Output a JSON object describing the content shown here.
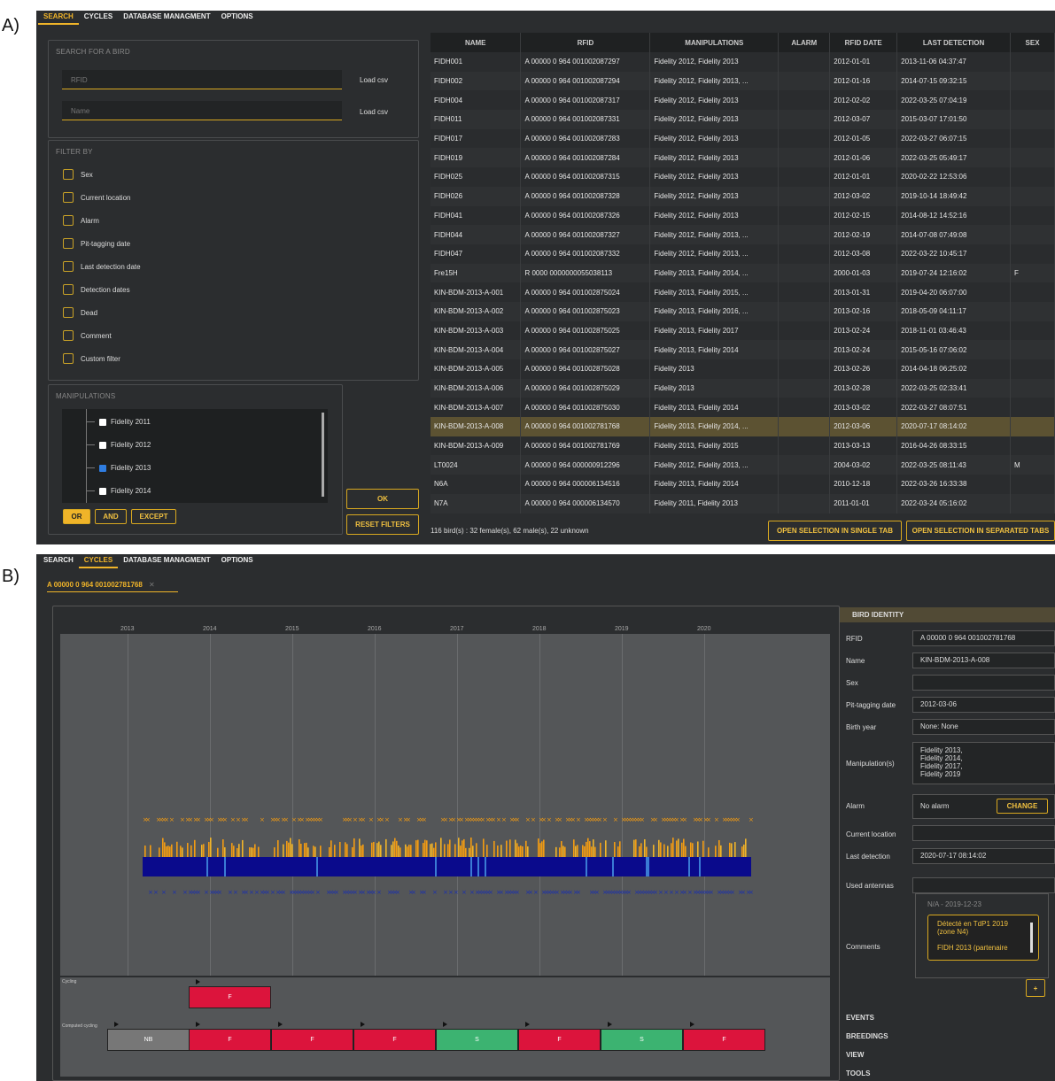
{
  "labels": {
    "a": "A)",
    "b": "B)"
  },
  "a": {
    "menu": [
      "SEARCH",
      "CYCLES",
      "DATABASE MANAGMENT",
      "OPTIONS"
    ],
    "search": {
      "title": "SEARCH FOR A BIRD",
      "rfid_ph": "RFID",
      "name_ph": "Name",
      "load": "Load csv"
    },
    "filter": {
      "title": "FILTER BY",
      "items": [
        "Sex",
        "Current location",
        "Alarm",
        "Pit-tagging date",
        "Last detection date",
        "Detection dates",
        "Dead",
        "Comment",
        "Custom filter"
      ]
    },
    "manip": {
      "title": "MANIPULATIONS",
      "items": [
        {
          "label": "Fidelity 2011",
          "checked": false
        },
        {
          "label": "Fidelity 2012",
          "checked": false
        },
        {
          "label": "Fidelity 2013",
          "checked": true
        },
        {
          "label": "Fidelity 2014",
          "checked": false
        }
      ],
      "ops": [
        "OR",
        "AND",
        "EXCEPT"
      ]
    },
    "ok": "OK",
    "reset": "RESET FILTERS",
    "columns": [
      "NAME",
      "RFID",
      "MANIPULATIONS",
      "ALARM",
      "RFID DATE",
      "LAST DETECTION",
      "SEX"
    ],
    "rows": [
      [
        "FIDH001",
        "A 00000 0 964 001002087297",
        "Fidelity 2012, Fidelity 2013",
        "",
        "2012-01-01",
        "2013-11-06 04:37:47",
        ""
      ],
      [
        "FIDH002",
        "A 00000 0 964 001002087294",
        "Fidelity 2012, Fidelity 2013, ...",
        "",
        "2012-01-16",
        "2014-07-15 09:32:15",
        ""
      ],
      [
        "FIDH004",
        "A 00000 0 964 001002087317",
        "Fidelity 2012, Fidelity 2013",
        "",
        "2012-02-02",
        "2022-03-25 07:04:19",
        ""
      ],
      [
        "FIDH011",
        "A 00000 0 964 001002087331",
        "Fidelity 2012, Fidelity 2013",
        "",
        "2012-03-07",
        "2015-03-07 17:01:50",
        ""
      ],
      [
        "FIDH017",
        "A 00000 0 964 001002087283",
        "Fidelity 2012, Fidelity 2013",
        "",
        "2012-01-05",
        "2022-03-27 06:07:15",
        ""
      ],
      [
        "FIDH019",
        "A 00000 0 964 001002087284",
        "Fidelity 2012, Fidelity 2013",
        "",
        "2012-01-06",
        "2022-03-25 05:49:17",
        ""
      ],
      [
        "FIDH025",
        "A 00000 0 964 001002087315",
        "Fidelity 2012, Fidelity 2013",
        "",
        "2012-01-01",
        "2020-02-22 12:53:06",
        ""
      ],
      [
        "FIDH026",
        "A 00000 0 964 001002087328",
        "Fidelity 2012, Fidelity 2013",
        "",
        "2012-03-02",
        "2019-10-14 18:49:42",
        ""
      ],
      [
        "FIDH041",
        "A 00000 0 964 001002087326",
        "Fidelity 2012, Fidelity 2013",
        "",
        "2012-02-15",
        "2014-08-12 14:52:16",
        ""
      ],
      [
        "FIDH044",
        "A 00000 0 964 001002087327",
        "Fidelity 2012, Fidelity 2013, ...",
        "",
        "2012-02-19",
        "2014-07-08 07:49:08",
        ""
      ],
      [
        "FIDH047",
        "A 00000 0 964 001002087332",
        "Fidelity 2012, Fidelity 2013, ...",
        "",
        "2012-03-08",
        "2022-03-22 10:45:17",
        ""
      ],
      [
        "Fre15H",
        "R 0000 0000000055038113",
        "Fidelity 2013, Fidelity 2014, ...",
        "",
        "2000-01-03",
        "2019-07-24 12:16:02",
        "F"
      ],
      [
        "KIN-BDM-2013-A-001",
        "A 00000 0 964 001002875024",
        "Fidelity 2013, Fidelity 2015, ...",
        "",
        "2013-01-31",
        "2019-04-20 06:07:00",
        ""
      ],
      [
        "KIN-BDM-2013-A-002",
        "A 00000 0 964 001002875023",
        "Fidelity 2013, Fidelity 2016, ...",
        "",
        "2013-02-16",
        "2018-05-09 04:11:17",
        ""
      ],
      [
        "KIN-BDM-2013-A-003",
        "A 00000 0 964 001002875025",
        "Fidelity 2013, Fidelity 2017",
        "",
        "2013-02-24",
        "2018-11-01 03:46:43",
        ""
      ],
      [
        "KIN-BDM-2013-A-004",
        "A 00000 0 964 001002875027",
        "Fidelity 2013, Fidelity 2014",
        "",
        "2013-02-24",
        "2015-05-16 07:06:02",
        ""
      ],
      [
        "KIN-BDM-2013-A-005",
        "A 00000 0 964 001002875028",
        "Fidelity 2013",
        "",
        "2013-02-26",
        "2014-04-18 06:25:02",
        ""
      ],
      [
        "KIN-BDM-2013-A-006",
        "A 00000 0 964 001002875029",
        "Fidelity 2013",
        "",
        "2013-02-28",
        "2022-03-25 02:33:41",
        ""
      ],
      [
        "KIN-BDM-2013-A-007",
        "A 00000 0 964 001002875030",
        "Fidelity 2013, Fidelity 2014",
        "",
        "2013-03-02",
        "2022-03-27 08:07:51",
        ""
      ],
      [
        "KIN-BDM-2013-A-008",
        "A 00000 0 964 001002781768",
        "Fidelity 2013, Fidelity 2014, ...",
        "",
        "2012-03-06",
        "2020-07-17 08:14:02",
        ""
      ],
      [
        "KIN-BDM-2013-A-009",
        "A 00000 0 964 001002781769",
        "Fidelity 2013, Fidelity 2015",
        "",
        "2013-03-13",
        "2016-04-26 08:33:15",
        ""
      ],
      [
        "LT0024",
        "A 00000 0 964 000000912296",
        "Fidelity 2012, Fidelity 2013, ...",
        "",
        "2004-03-02",
        "2022-03-25 08:11:43",
        "M"
      ],
      [
        "N6A",
        "A 00000 0 964 000006134516",
        "Fidelity 2013, Fidelity 2014",
        "",
        "2010-12-18",
        "2022-03-26 16:33:38",
        ""
      ],
      [
        "N7A",
        "A 00000 0 964 000006134570",
        "Fidelity 2011, Fidelity 2013",
        "",
        "2011-01-01",
        "2022-03-24 05:16:02",
        ""
      ]
    ],
    "selected_row": 19,
    "status": "116 bird(s) : 32 female(s), 62 male(s), 22 unknown",
    "open_single": "OPEN SELECTION IN SINGLE TAB",
    "open_sep": "OPEN SELECTION IN SEPARATED TABS"
  },
  "b": {
    "menu": [
      "SEARCH",
      "CYCLES",
      "DATABASE MANAGMENT",
      "OPTIONS"
    ],
    "tab": "A 00000 0 964 001002781768",
    "tab_close": "✕",
    "years": [
      "2013",
      "2014",
      "2015",
      "2016",
      "2017",
      "2018",
      "2019",
      "2020"
    ],
    "cycling_label": "Cycling",
    "computed_label": "Computed cycling",
    "cycling": [
      {
        "label": "F",
        "color": "#dc143c"
      }
    ],
    "computed": [
      {
        "label": "NB",
        "color": "#777777"
      },
      {
        "label": "F",
        "color": "#dc143c"
      },
      {
        "label": "F",
        "color": "#dc143c"
      },
      {
        "label": "F",
        "color": "#dc143c"
      },
      {
        "label": "S",
        "color": "#3cb371"
      },
      {
        "label": "F",
        "color": "#dc143c"
      },
      {
        "label": "S",
        "color": "#3cb371"
      },
      {
        "label": "F",
        "color": "#dc143c"
      }
    ],
    "identity": {
      "title": "BIRD IDENTITY",
      "fields": [
        {
          "label": "RFID",
          "value": "A 00000 0 964 001002781768"
        },
        {
          "label": "Name",
          "value": "KIN-BDM-2013-A-008"
        },
        {
          "label": "Sex",
          "value": ""
        },
        {
          "label": "Pit-tagging date",
          "value": "2012-03-06"
        },
        {
          "label": "Birth year",
          "value": "None: None"
        }
      ],
      "manip_label": "Manipulation(s)",
      "manip_lines": [
        "Fidelity 2013,",
        "Fidelity 2014,",
        "Fidelity 2017,",
        "Fidelity 2019"
      ],
      "alarm_label": "Alarm",
      "alarm_value": "No alarm",
      "change": "CHANGE",
      "loc_label": "Current location",
      "loc_value": "",
      "last_label": "Last detection",
      "last_value": "2020-07-17 08:14:02",
      "ant_label": "Used antennas",
      "ant_value": "",
      "comments_label": "Comments",
      "comment_date": "N/A - 2019-12-23",
      "comment_l1": "Détecté en TdP1 2019",
      "comment_l2": "(zone N4)",
      "comment_l3": "FIDH 2013 (partenaire",
      "plus": "+"
    },
    "accordions": [
      "EVENTS",
      "BREEDINGS",
      "VIEW",
      "TOOLS"
    ]
  }
}
